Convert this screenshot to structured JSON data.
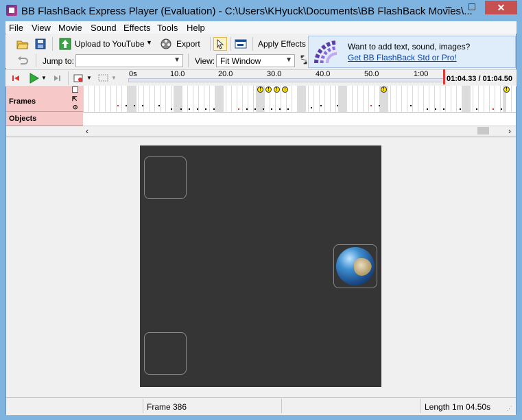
{
  "window": {
    "title": "BB FlashBack Express Player (Evaluation) - C:\\Users\\KHyuck\\Documents\\BB FlashBack Movies\\...",
    "close_glyph": "✕"
  },
  "menu": [
    "File",
    "View",
    "Movie",
    "Sound",
    "Effects",
    "Tools",
    "Help"
  ],
  "toolbar": {
    "upload_label": "Upload to YouTube",
    "export_label": "Export",
    "apply_effects_label": "Apply Effects",
    "jump_to_label": "Jump to:",
    "jump_to_value": "",
    "view_label": "View:",
    "view_value": "Fit Window"
  },
  "ad": {
    "line1": "Want to add text, sound, images?",
    "link": "Get BB FlashBack Std or Pro!"
  },
  "timeline": {
    "ticks": [
      "0s",
      "10.0",
      "20.0",
      "30.0",
      "40.0",
      "50.0",
      "1:00"
    ],
    "time_readout": "01:04.33 / 01:04.50",
    "rows": {
      "frames": "Frames",
      "objects": "Objects"
    },
    "marker_glyph": "!"
  },
  "status": {
    "frame": "Frame 386",
    "length": "Length 1m 04.50s"
  },
  "icons": [
    "app-icon",
    "open-folder-icon",
    "save-icon",
    "upload-icon",
    "export-film-icon",
    "cursor-icon",
    "window-icon",
    "undo-icon",
    "fit-expand-icon",
    "rewind-icon",
    "play-icon",
    "next-frame-icon",
    "record-icon",
    "caption-icon",
    "globe-icon"
  ],
  "colors": {
    "accent_red": "#e03a3a",
    "track_label_bg": "#f7c8c8",
    "stage_bg": "#353535",
    "link": "#0645ad"
  }
}
